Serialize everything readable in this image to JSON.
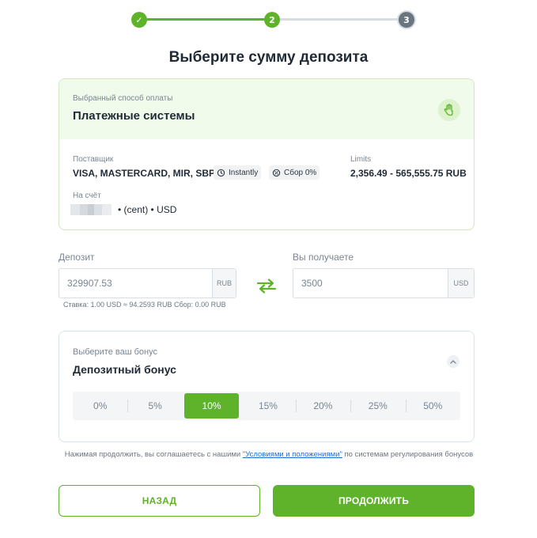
{
  "stepper": {
    "steps": [
      {
        "label": "",
        "state": "done"
      },
      {
        "label": "2",
        "state": "current"
      },
      {
        "label": "3",
        "state": "upcoming"
      }
    ],
    "done_mark": "✓"
  },
  "title": "Выберите сумму депозита",
  "payment": {
    "label": "Выбранный способ оплаты",
    "method": "Платежные системы",
    "icon": "hand-icon",
    "provider_label": "Поставщик",
    "provider": "VISA, MASTERCARD, MIR, SBP",
    "speed_chip": "Instantly",
    "fee_chip": "Сбор 0%",
    "limits_label": "Limits",
    "limits": "2,356.49 - 565,555.75 RUB",
    "account_label": "На счёт",
    "account_suffix": "• (cent) • USD"
  },
  "deposit": {
    "label": "Депозит",
    "value": "329907.53",
    "currency": "RUB",
    "rate": "Ставка: 1.00 USD ≈ 94.2593 RUB Сбор: 0.00 RUB"
  },
  "receive": {
    "label": "Вы получаете",
    "value": "3500",
    "currency": "USD"
  },
  "bonus": {
    "label": "Выберите ваш бонус",
    "title": "Депозитный бонус",
    "options": [
      "0%",
      "5%",
      "10%",
      "15%",
      "20%",
      "25%",
      "50%"
    ],
    "selected": "10%"
  },
  "terms": {
    "before": "Нажимая продолжить, вы соглашаетесь с нашими ",
    "link": "\"Условиями и положениями\"",
    "after": " по системам регулирования бонусов"
  },
  "buttons": {
    "back": "НАЗАД",
    "next": "ПРОДОЛЖИТЬ"
  },
  "colors": {
    "accent": "#5fb32b",
    "link": "#1f6fd0"
  }
}
